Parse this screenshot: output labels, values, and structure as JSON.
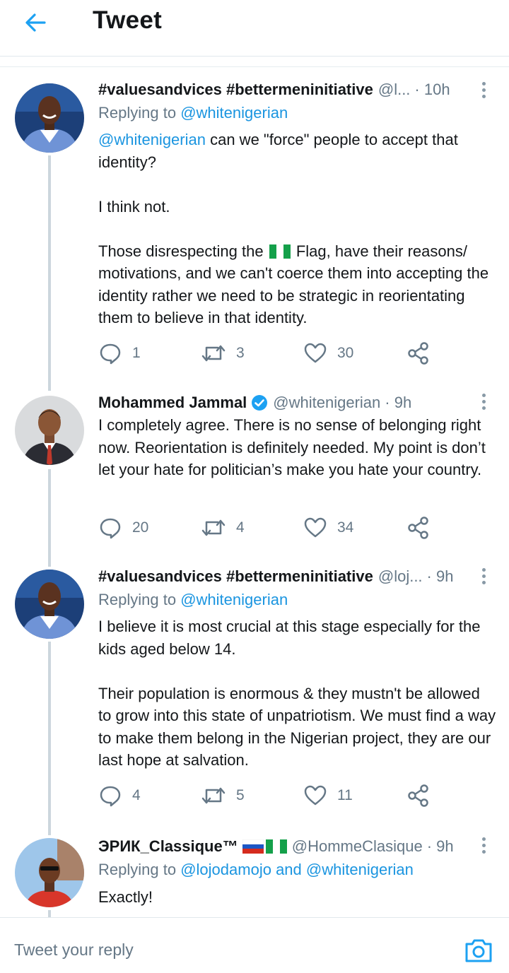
{
  "header": {
    "title": "Tweet",
    "back_icon": "arrow-left-icon",
    "accent": "#1da1f2"
  },
  "tweets": [
    {
      "name": "#valuesandvices #bettermeninitiative",
      "handle": "@l...",
      "time": "· 10h",
      "replying_label": "Replying to",
      "replying_to": "@whitenigerian",
      "mention": "@whitenigerian",
      "body_1": " can we \"force\" people to accept that identity?",
      "body_2": "I think not.",
      "body_3a": "Those disrespecting the",
      "body_3b": "Flag, have their reasons/ motivations, and we can't coerce them into accepting the identity rather we need to be strategic in reorientating them to believe in that identity.",
      "replies": "1",
      "retweets": "3",
      "likes": "30"
    },
    {
      "name": "Mohammed Jammal",
      "handle": "@whitenigerian",
      "time": "· 9h",
      "verified": true,
      "body": "I completely agree. There is no sense of belonging right now. Reorientation is definitely needed. My point is don’t let your hate for politician’s make you hate your country.",
      "replies": "20",
      "retweets": "4",
      "likes": "34"
    },
    {
      "name": "#valuesandvices #bettermeninitiative",
      "handle": "@loj...",
      "time": "· 9h",
      "replying_label": "Replying to",
      "replying_to": "@whitenigerian",
      "body_1": "I believe it is most crucial at this stage especially for the kids aged below 14.",
      "body_2": "Their population is enormous & they mustn't be allowed to grow into this state of unpatriotism. We must find a way to make them belong in the Nigerian project, they are our last hope at salvation.",
      "replies": "4",
      "retweets": "5",
      "likes": "11"
    },
    {
      "name": "ЭРИК_Classique™",
      "handle": "@HommeClasique",
      "time": "· 9h",
      "flags": [
        "russia-flag-icon",
        "nigeria-flag-icon"
      ],
      "replying_label": "Replying to",
      "replying_to_1": "@lojodamojo",
      "replying_and": "and",
      "replying_to_2": "@whitenigerian",
      "body": "Exactly!"
    }
  ],
  "reply_bar": {
    "placeholder": "Tweet your reply",
    "camera_icon": "camera-icon"
  },
  "colors": {
    "link": "#1b95e0",
    "muted": "#657786",
    "icon": "#657786",
    "thread_line": "#ccd6dd"
  }
}
